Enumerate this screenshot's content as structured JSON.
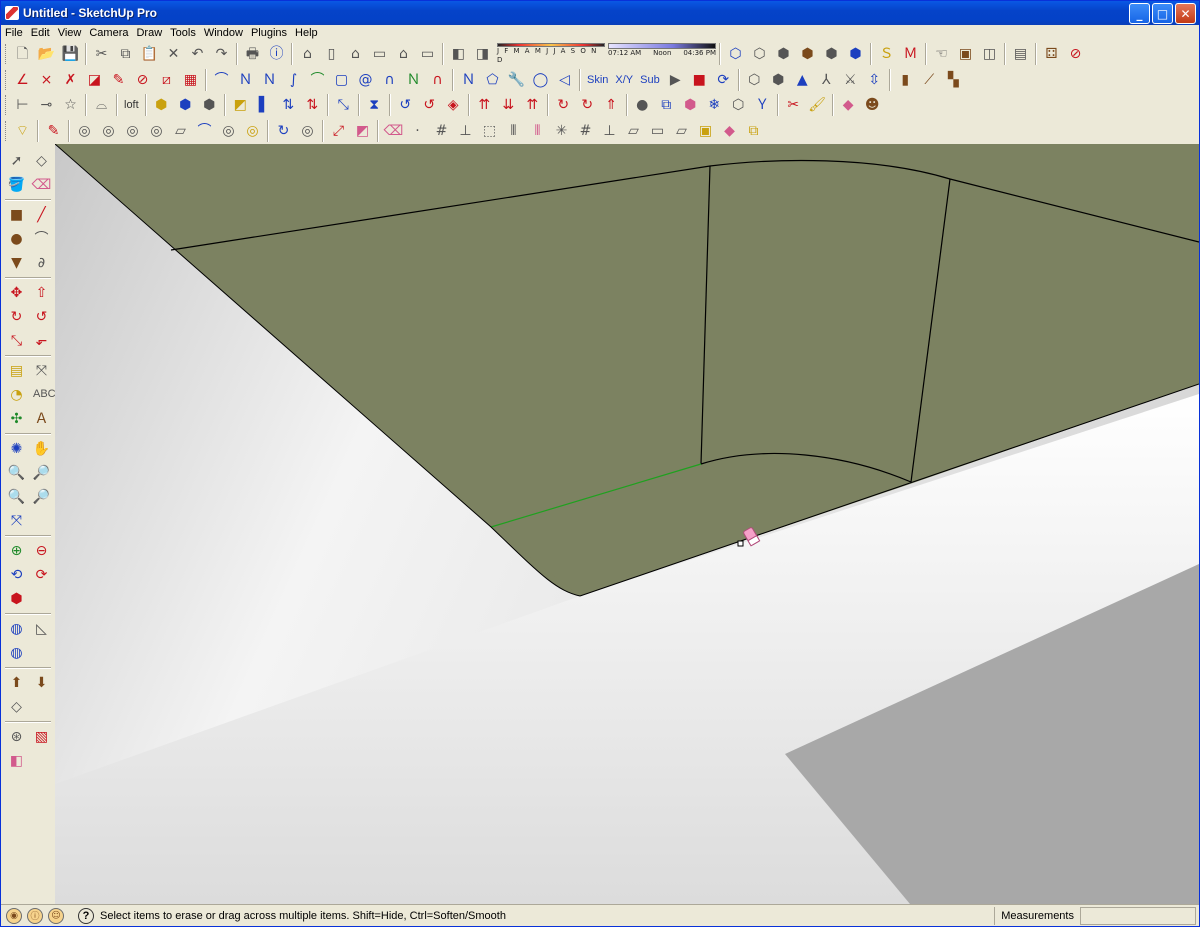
{
  "window": {
    "title": "Untitled - SketchUp Pro",
    "minimize_glyph": "_",
    "maximize_glyph": "□",
    "close_glyph": "✕"
  },
  "menubar": {
    "items": [
      "File",
      "Edit",
      "View",
      "Camera",
      "Draw",
      "Tools",
      "Window",
      "Plugins",
      "Help"
    ]
  },
  "shadow_settings": {
    "months": "J F M A M J J A S O N D",
    "time_start": "07:12 AM",
    "time_mid": "Noon",
    "time_end": "04:36 PM"
  },
  "toolbar": {
    "loft_label": "loft",
    "skin_label": "Skin",
    "xy_label": "X/Y",
    "sub_label": "Sub",
    "text_tool_label": "ABC"
  },
  "statusbar": {
    "hint": "Select items to erase or drag across multiple items. Shift=Hide, Ctrl=Soften/Smooth",
    "measurements_label": "Measurements",
    "measurements_value": ""
  },
  "colors": {
    "face_front": "#7c8261",
    "edge": "#000000",
    "green_axis": "#1fa11f",
    "titlebar": "#0543c9",
    "chrome": "#ece9d8",
    "eraser_cursor": "#f5a0c8"
  }
}
